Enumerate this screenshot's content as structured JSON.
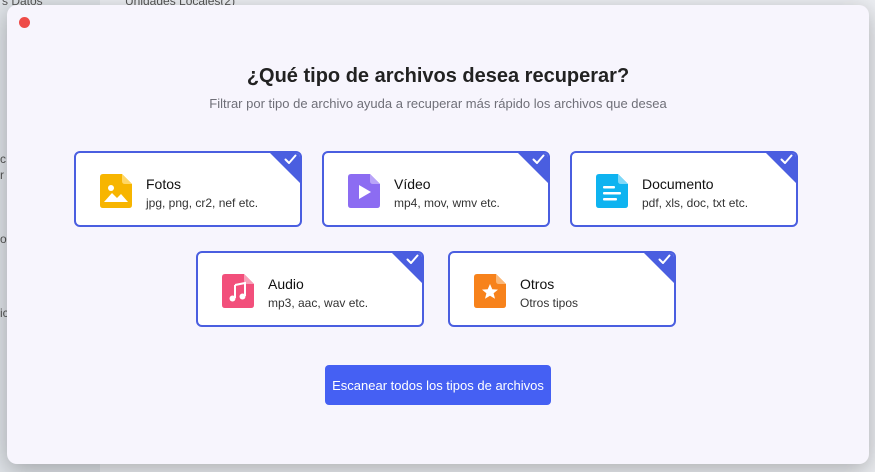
{
  "background": {
    "sidebar_text": "s Datos",
    "header_text": "Unidades Locales(2)",
    "fragments": [
      "c",
      "r",
      "o",
      "ic"
    ]
  },
  "modal": {
    "title": "¿Qué tipo de archivos desea recuperar?",
    "subtitle": "Filtrar por tipo de archivo ayuda a recuperar más rápido los archivos que desea",
    "scan_button": "Escanear todos los tipos de archivos"
  },
  "cards": [
    {
      "title": "Fotos",
      "subtitle": "jpg, png, cr2, nef etc.",
      "icon": "image-icon",
      "color": "#f7b500",
      "checked": true
    },
    {
      "title": "Vídeo",
      "subtitle": "mp4, mov, wmv etc.",
      "icon": "video-icon",
      "color": "#8c6cf2",
      "checked": true
    },
    {
      "title": "Documento",
      "subtitle": "pdf, xls, doc, txt etc.",
      "icon": "document-icon",
      "color": "#0eb3f0",
      "checked": true
    },
    {
      "title": "Audio",
      "subtitle": "mp3, aac, wav etc.",
      "icon": "music-icon",
      "color": "#f24f7b",
      "checked": true
    },
    {
      "title": "Otros",
      "subtitle": "Otros tipos",
      "icon": "star-icon",
      "color": "#f7821b",
      "checked": true
    }
  ],
  "colors": {
    "accent": "#4a5ee0",
    "button": "#4560f3",
    "close": "#ee4b48"
  }
}
